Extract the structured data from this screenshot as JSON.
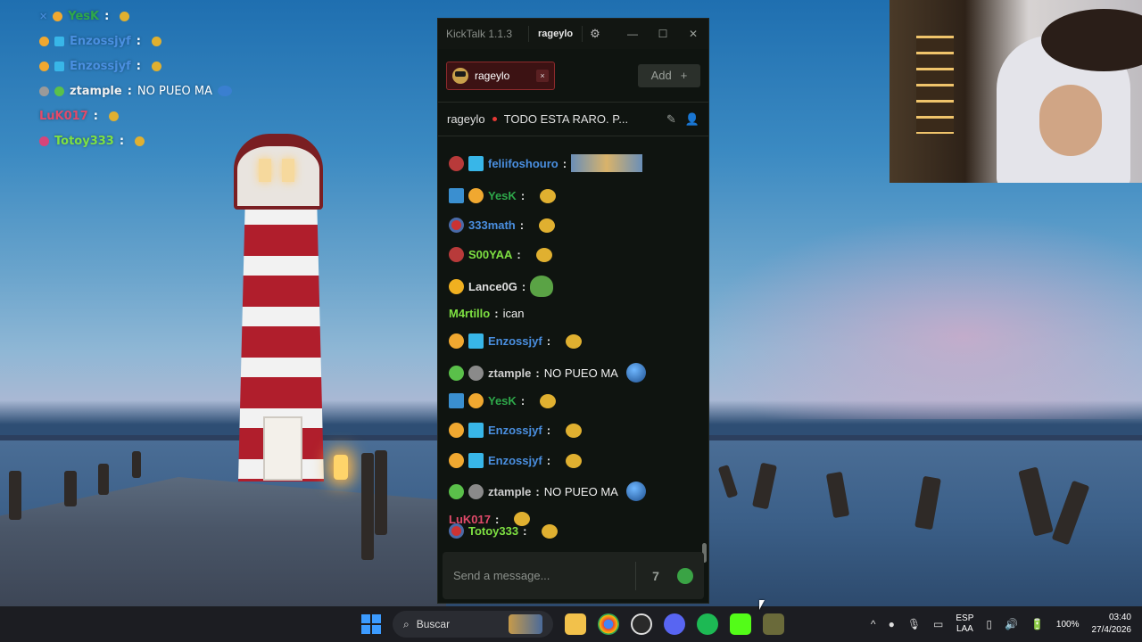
{
  "overlay_chat": [
    {
      "user": "YesK",
      "color": "#2ea84a",
      "message": "",
      "suffix": ":"
    },
    {
      "user": "Enzossjyf",
      "color": "#4a8fe0",
      "message": "",
      "suffix": ":"
    },
    {
      "user": "Enzossjyf",
      "color": "#4a8fe0",
      "message": "",
      "suffix": ":"
    },
    {
      "user": "ztample",
      "color": "#f0f0f0",
      "message": "NO PUEO MA",
      "suffix": ":"
    },
    {
      "user": "LuK017",
      "color": "#e24a6a",
      "message": "",
      "suffix": ":"
    },
    {
      "user": "Totoy333",
      "color": "#7ee042",
      "message": "",
      "suffix": ":"
    }
  ],
  "kicktalk": {
    "app_title": "KickTalk 1.1.3",
    "account": "rageylo",
    "tab": {
      "label": "rageylo",
      "close": "×"
    },
    "add_button": "Add",
    "add_icon": "+",
    "header": {
      "channel": "rageylo",
      "stream_title": "TODO ESTA RARO. P..."
    },
    "messages": [
      {
        "user": "feliifoshouro",
        "color": "#4a8fe0",
        "text": ""
      },
      {
        "user": "YesK",
        "color": "#2ea84a",
        "text": ""
      },
      {
        "user": "333math",
        "color": "#4a8fe0",
        "text": ""
      },
      {
        "user": "S00YAA",
        "color": "#7ee042",
        "text": ""
      },
      {
        "user": "Lance0G",
        "color": "#e0e0e0",
        "text": ""
      },
      {
        "user": "M4rtillo",
        "color": "#7ee042",
        "text": "ican"
      },
      {
        "user": "Enzossjyf",
        "color": "#4a8fe0",
        "text": ""
      },
      {
        "user": "ztample",
        "color": "#cfcfcf",
        "text": "NO PUEO MA"
      },
      {
        "user": "YesK",
        "color": "#2ea84a",
        "text": ""
      },
      {
        "user": "Enzossjyf",
        "color": "#4a8fe0",
        "text": ""
      },
      {
        "user": "Enzossjyf",
        "color": "#4a8fe0",
        "text": ""
      },
      {
        "user": "ztample",
        "color": "#cfcfcf",
        "text": "NO PUEO MA"
      },
      {
        "user": "LuK017",
        "color": "#e24a6a",
        "text": ""
      },
      {
        "user": "Totoy333",
        "color": "#7ee042",
        "text": ""
      }
    ],
    "input_placeholder": "Send a message..."
  },
  "taskbar": {
    "search_label": "Buscar",
    "lang_top": "ESP",
    "lang_bottom": "LAA",
    "battery": "100%",
    "time": "03:40",
    "date": "27/4/2026"
  }
}
